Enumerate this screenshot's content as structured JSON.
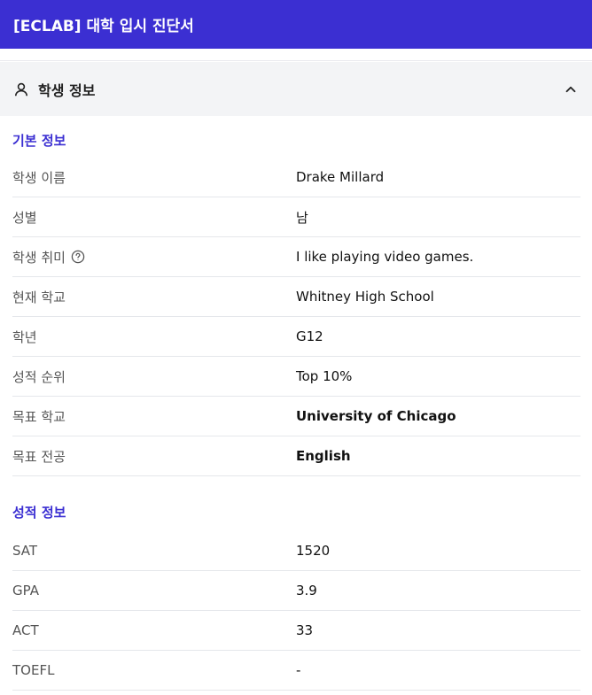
{
  "header": {
    "title": "[ECLAB] 대학 입시 진단서"
  },
  "section": {
    "title": "학생 정보",
    "icon": "user-icon",
    "toggle_icon": "chevron-up-icon",
    "accent_color": "#3b2fd2"
  },
  "basic_info": {
    "title": "기본 정보",
    "rows": [
      {
        "label": "학생 이름",
        "value": "Drake Millard"
      },
      {
        "label": "성별",
        "value": "남"
      },
      {
        "label": "학생 취미",
        "value": "I like playing video games."
      },
      {
        "label": "현재 학교",
        "value": "Whitney High School"
      },
      {
        "label": "학년",
        "value": "G12"
      },
      {
        "label": "성적 순위",
        "value": "Top 10%"
      },
      {
        "label": "목표 학교",
        "value": "University of Chicago"
      },
      {
        "label": "목표 전공",
        "value": "English"
      }
    ]
  },
  "score_info": {
    "title": "성적 정보",
    "rows": [
      {
        "label": "SAT",
        "value": "1520"
      },
      {
        "label": "GPA",
        "value": "3.9"
      },
      {
        "label": "ACT",
        "value": "33"
      },
      {
        "label": "TOEFL",
        "value": "-"
      }
    ]
  }
}
